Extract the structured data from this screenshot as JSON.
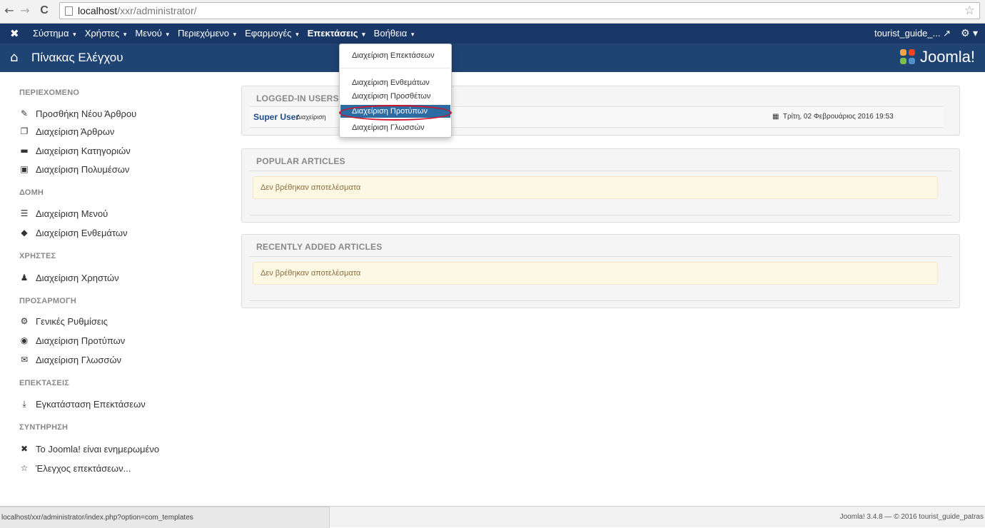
{
  "browser": {
    "back_icon": "←",
    "forward_icon": "→",
    "reload_icon": "C",
    "url_host": "localhost",
    "url_path": "/xxr/administrator/",
    "star_icon": "☆"
  },
  "topnav": {
    "logo_icon": "joomla-x-icon",
    "items": [
      {
        "label": "Σύστημα"
      },
      {
        "label": "Χρήστες"
      },
      {
        "label": "Μενού"
      },
      {
        "label": "Περιεχόμενο"
      },
      {
        "label": "Εφαρμογές"
      },
      {
        "label": "Επεκτάσεις"
      },
      {
        "label": "Βοήθεια"
      }
    ],
    "caret": "▾",
    "user_label": "tourist_guide_... ",
    "external_icon": "↗",
    "gear_icon": "⚙ ▾"
  },
  "header": {
    "home_icon": "⌂",
    "title": "Πίνακας Ελέγχου",
    "brand": "Joomla!"
  },
  "sidebar": {
    "sections": [
      {
        "heading": "ΠΕΡΙΕΧΟΜΕΝΟ",
        "items": [
          {
            "label": "Προσθήκη Νέου Άρθρου",
            "icon": "✎"
          },
          {
            "label": "Διαχείριση Άρθρων",
            "icon": "❐"
          },
          {
            "label": "Διαχείριση Κατηγοριών",
            "icon": "▬"
          },
          {
            "label": "Διαχείριση Πολυμέσων",
            "icon": "▣"
          }
        ]
      },
      {
        "heading": "ΔΟΜΗ",
        "items": [
          {
            "label": "Διαχείριση Μενού",
            "icon": "☰"
          },
          {
            "label": "Διαχείριση Ενθεμάτων",
            "icon": "◆"
          }
        ]
      },
      {
        "heading": "ΧΡΗΣΤΕΣ",
        "items": [
          {
            "label": "Διαχείριση Χρηστών",
            "icon": "♟"
          }
        ]
      },
      {
        "heading": "ΠΡΟΣΑΡΜΟΓΗ",
        "items": [
          {
            "label": "Γενικές Ρυθμίσεις",
            "icon": "⚙"
          },
          {
            "label": "Διαχείριση Προτύπων",
            "icon": "◉"
          },
          {
            "label": "Διαχείριση Γλωσσών",
            "icon": "✉"
          }
        ]
      },
      {
        "heading": "ΕΠΕΚΤΑΣΕΙΣ",
        "items": [
          {
            "label": "Εγκατάσταση Επεκτάσεων",
            "icon": "⤓"
          }
        ]
      },
      {
        "heading": "ΣΥΝΤΗΡΗΣΗ",
        "items": [
          {
            "label": "Το Joomla! είναι ενημερωμένο",
            "icon": "✖"
          },
          {
            "label": "Έλεγχος επεκτάσεων...",
            "icon": "☆"
          }
        ]
      }
    ]
  },
  "panels": {
    "logged_in": {
      "title": "LOGGED-IN USERS",
      "user_name": "Super User",
      "user_role": "Διαχείριση",
      "calendar_icon": "▦",
      "date": "Τρίτη, 02 Φεβρουάριος 2016 19:53"
    },
    "popular": {
      "title": "POPULAR ARTICLES",
      "empty_text": "Δεν βρέθηκαν αποτελέσματα"
    },
    "recent": {
      "title": "RECENTLY ADDED ARTICLES",
      "empty_text": "Δεν βρέθηκαν αποτελέσματα"
    }
  },
  "dropdown": {
    "items": [
      {
        "label": "Διαχείριση Επεκτάσεων"
      },
      {
        "label": "Διαχείριση Ενθεμάτων"
      },
      {
        "label": "Διαχείριση Προσθέτων"
      },
      {
        "label": "Διαχείριση Προτύπων"
      },
      {
        "label": "Διαχείριση Γλωσσών"
      }
    ]
  },
  "status": {
    "hover_url": "localhost/xxr/administrator/index.php?option=com_templates",
    "footer": "Joomla! 3.4.8 — © 2016 tourist_guide_patras"
  },
  "colors": {
    "topnav": "#1a3867",
    "header": "#1f4372",
    "dropdown_active": "#2d6ca2",
    "highlight_ring": "#d0142a",
    "alert_bg": "#fcf8e3"
  }
}
